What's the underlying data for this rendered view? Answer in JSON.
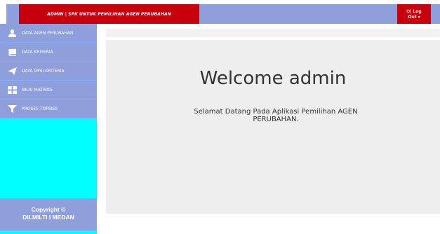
{
  "header": {
    "brand": "ADMIN | SPK UNTUK PEMILIHAN AGEN PERUBAHAN",
    "logout_line1": "⏻| Log",
    "logout_line2": "Out ▾"
  },
  "sidebar": {
    "items": [
      {
        "label": "DATA AGEN PERUBAHAN",
        "icon": "user-icon"
      },
      {
        "label": "DATA KRITERIA",
        "icon": "book-icon"
      },
      {
        "label": "DATA OPSI KRITERIA",
        "icon": "paper-plane-icon"
      },
      {
        "label": "NILAI MATRIKS",
        "icon": "th-large-icon"
      },
      {
        "label": "PROSES TOPSISS",
        "icon": "filter-icon"
      }
    ],
    "copyright_line1": "Copyright ©",
    "copyright_line2": "DILMILTI I MEDAN"
  },
  "main": {
    "welcome": "Welcome admin",
    "subtitle": "Selamat Datang Pada Aplikasi Pemilihan AGEN PERUBAHAN."
  },
  "colors": {
    "header_bg": "#8f9fdc",
    "brand_bg": "#c8000c",
    "sidebar_bg": "#00ffff",
    "nav_bg": "#8f9fdc"
  }
}
